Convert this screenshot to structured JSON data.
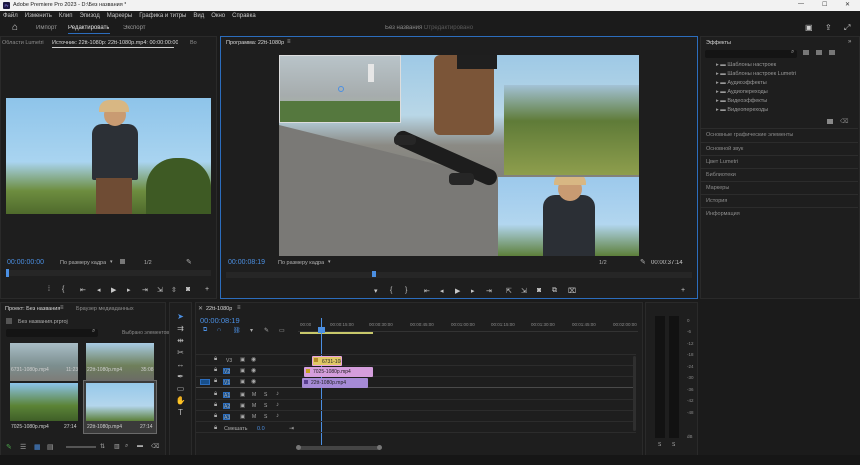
{
  "window": {
    "title": "Adobe Premiere Pro 2023 - D:\\Без названия *",
    "controls": {
      "minimize": "—",
      "maximize": "☐",
      "close": "✕"
    }
  },
  "menu": [
    "Файл",
    "Изменить",
    "Клип",
    "Эпизод",
    "Маркеры",
    "Графика и титры",
    "Вид",
    "Окно",
    "Справка"
  ],
  "workspace": {
    "tabs": [
      "Импорт",
      "Редактировать",
      "Экспорт"
    ],
    "active_tab": "Редактировать",
    "project_title": "Без названия",
    "project_status": "- Отредактировано"
  },
  "source_monitor": {
    "tabs": [
      "Области Lumetri",
      "Источник: 22tt-1080p: 22tt-1080p.mp4: 00:00:00:00",
      "Во"
    ],
    "timecode": "00:00:00:00",
    "fit": "По размеру кадра",
    "scale": "1/2"
  },
  "program_monitor": {
    "title": "Программа: 22tt-1080p",
    "timecode": "00:00:08:19",
    "fit": "По размеру кадра",
    "scale": "1/2",
    "duration": "00:00:37:14"
  },
  "effects": {
    "title": "Эффекты",
    "items": [
      "Шаблоны настроек",
      "Шаблоны настроек Lumetri",
      "Аудиоэффекты",
      "Аудиопереходы",
      "Видеоэффекты",
      "Видеопереходы"
    ],
    "sections": [
      "Основные графические элементы",
      "Основной звук",
      "Цвет Lumetri",
      "Библиотеки",
      "Маркеры",
      "История",
      "Информация"
    ]
  },
  "project": {
    "tabs": [
      "Проект: Без названия",
      "Браузер медиаданных"
    ],
    "file": "Без названия.prproj",
    "search_placeholder": "",
    "count": "Выбрано элементов",
    "thumbs": [
      {
        "name": "6731-1080p.mp4",
        "dur": "11:23"
      },
      {
        "name": "22tt-1080p.mp4",
        "dur": "35:08"
      },
      {
        "name": "7025-1080p.mp4",
        "dur": "27:14"
      },
      {
        "name": "22tt-1080p.mp4",
        "dur": "27:14"
      }
    ]
  },
  "timeline": {
    "sequence": "22tt-1080p",
    "timecode": "00:00:08:19",
    "ruler": [
      "00:00",
      "00:00:15:00",
      "00:00:30:00",
      "00:00:45:00",
      "00:01:00:00",
      "00:01:15:00",
      "00:01:30:00",
      "00:01:45:00",
      "00:02:00:00"
    ],
    "tracks": [
      "V3",
      "V2",
      "V1",
      "A1",
      "A2",
      "A3"
    ],
    "mix_label": "Смешать",
    "mix_value": "0.0",
    "clips": [
      {
        "label": "6731-1080p"
      },
      {
        "label": "7025-1080p.mp4"
      },
      {
        "label": "22tt-1080p.mp4"
      }
    ]
  },
  "vu": {
    "ticks": [
      "0",
      "-6",
      "-12",
      "-18",
      "-24",
      "-30",
      "-36",
      "-42",
      "-48",
      "dB"
    ],
    "solo": [
      "S",
      "S"
    ]
  },
  "colors": {
    "accent": "#2c6dbd",
    "timecode": "#4b8fe2",
    "clip_purple": "#a58ad6",
    "clip_pink": "#d59edd",
    "clip_yellow": "#e0c866"
  }
}
